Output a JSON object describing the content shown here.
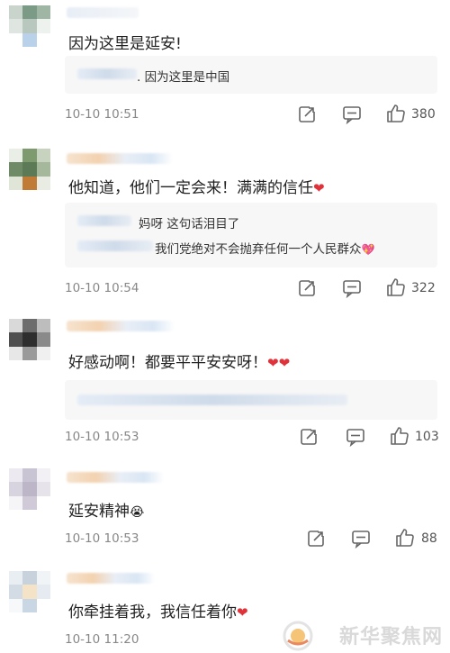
{
  "comments": [
    {
      "text": "因为这里是延安!",
      "reply": {
        "lines": [
          ". 因为这里是中国"
        ]
      },
      "time": "10-10 10:51",
      "likes": "380"
    },
    {
      "text": "他知道，他们一定会来！满满的信任",
      "text_suffix": "❤",
      "reply": {
        "lines": [
          "妈呀  这句话泪目了",
          "我们党绝对不会抛弃任何一个人民群众"
        ],
        "line2_suffix": "💖"
      },
      "time": "10-10 10:54",
      "likes": "322"
    },
    {
      "text": "好感动啊！都要平平安安呀！",
      "text_suffix": "❤❤",
      "time": "10-10 10:53",
      "likes": "103"
    },
    {
      "text": "延安精神",
      "text_suffix": "😭",
      "time": "10-10 10:53",
      "likes": "88"
    },
    {
      "text": "你牵挂着我，我信任着你",
      "text_suffix": "❤",
      "time": "10-10 11:20"
    }
  ],
  "watermark": {
    "text": "新华聚焦网"
  },
  "icons": {
    "share": "share-icon",
    "comment": "comment-icon",
    "like": "thumbs-up-icon"
  },
  "colors": {
    "heart": "#e0323a",
    "time": "#888888",
    "reply_bg": "#f7f7f7"
  }
}
